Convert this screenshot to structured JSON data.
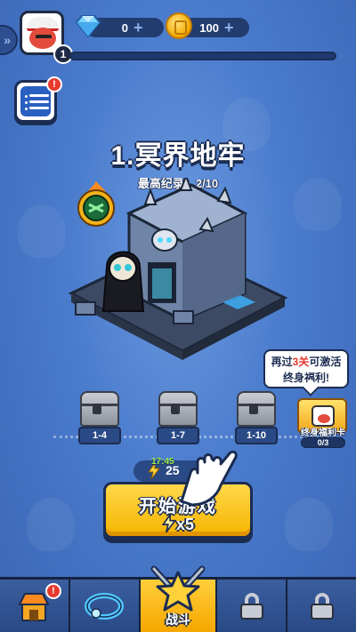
{
  "currencies": {
    "gems": "0",
    "coins": "100",
    "gem_plus": "+",
    "coin_plus": "+"
  },
  "player": {
    "level": "1"
  },
  "menu": {
    "notification": "!"
  },
  "level": {
    "title": "1.冥界地牢",
    "best_record": "最高纪录：2/10"
  },
  "tooltip": {
    "line1_pre": "再过",
    "line1_highlight": "3关",
    "line1_post": "可激活",
    "line2": "终身福利!"
  },
  "chests": [
    {
      "label": "1-4"
    },
    {
      "label": "1-7"
    },
    {
      "label": "1-10"
    }
  ],
  "reward_card": {
    "label": "终身福利卡",
    "progress": "0/3"
  },
  "energy": {
    "timer": "17:45",
    "value": "25"
  },
  "start_button": {
    "label": "开始游戏",
    "cost": "x5"
  },
  "nav": {
    "shop_notification": "!",
    "battle_label": "战斗"
  },
  "colors": {
    "accent": "#f6b400",
    "background": "#4a7bcc",
    "dark": "#1b2c52",
    "alert": "#e8392e"
  },
  "icons": {
    "gem": "diamond-icon",
    "coin": "coin-icon",
    "menu": "list-icon",
    "shop": "shop-icon",
    "skill": "ring-icon",
    "battle": "star-swords-icon",
    "locked": "padlock-icon"
  }
}
